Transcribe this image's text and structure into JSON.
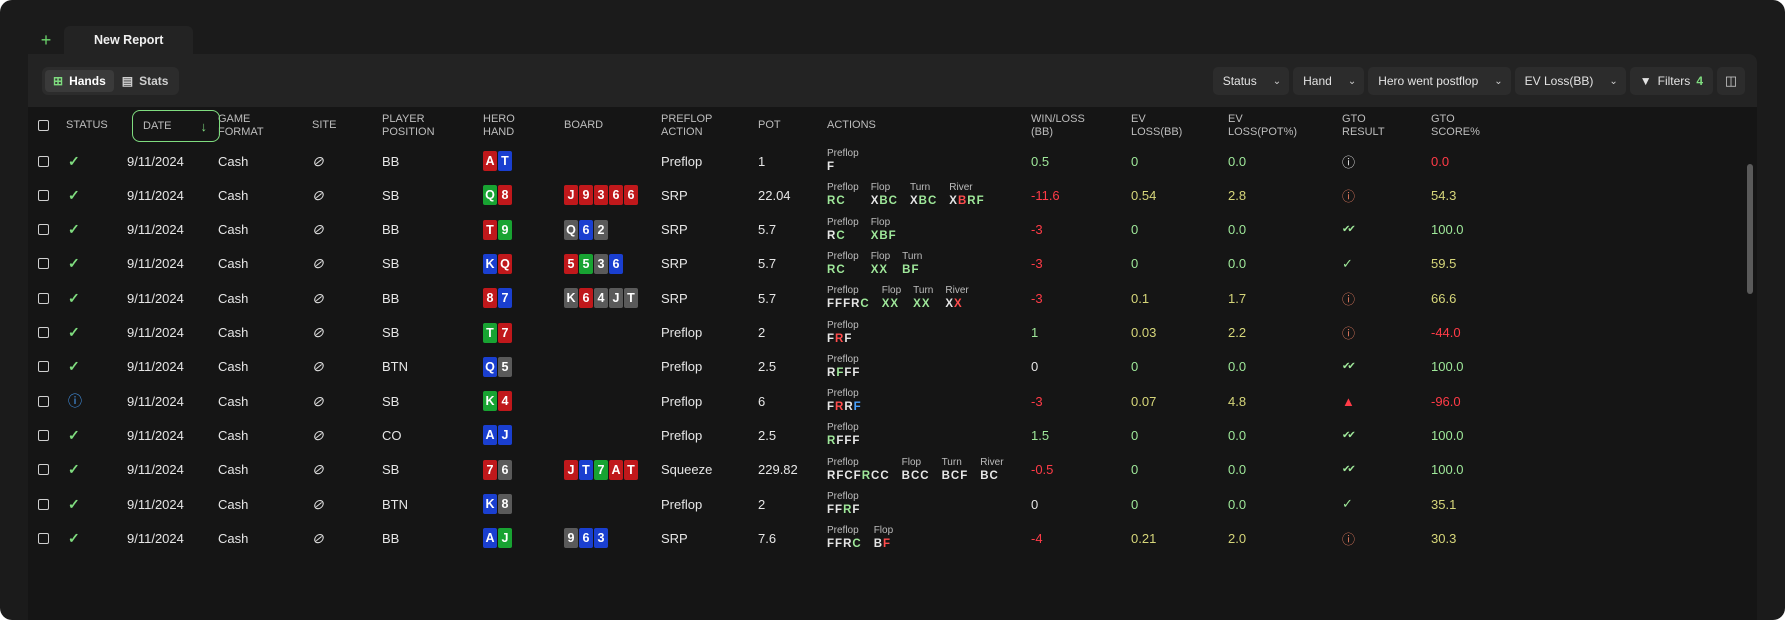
{
  "tabs": {
    "add_label": "+",
    "report_label": "New Report"
  },
  "view_toggle": {
    "hands_label": "Hands",
    "stats_label": "Stats"
  },
  "filters": {
    "status_label": "Status",
    "hand_label": "Hand",
    "postflop_label": "Hero went postflop",
    "evloss_label": "EV Loss(BB)",
    "filters_label": "Filters",
    "filters_count": "4"
  },
  "columns": {
    "status": "STATUS",
    "date": "DATE",
    "game_format": "GAME\nFORMAT",
    "site": "SITE",
    "player_position": "PLAYER\nPOSITION",
    "hero_hand": "HERO\nHAND",
    "board": "BOARD",
    "preflop_action": "PREFLOP\nACTION",
    "pot": "POT",
    "actions": "ACTIONS",
    "win_loss": "WIN/LOSS\n(BB)",
    "ev_loss_bb": "EV\nLOSS(BB)",
    "ev_loss_pot": "EV\nLOSS(POT%)",
    "gto_result": "GTO\nRESULT",
    "gto_score": "GTO\nSCORE%"
  },
  "rows": [
    {
      "status": "check",
      "date": "9/11/2024",
      "format": "Cash",
      "position": "BB",
      "hand": [
        {
          "r": "A",
          "c": "r"
        },
        {
          "r": "T",
          "c": "b"
        }
      ],
      "board": [],
      "preflop": "Preflop",
      "pot": "1",
      "actions": [
        {
          "street": "Preflop",
          "acts": [
            [
              "F",
              "w"
            ]
          ]
        }
      ],
      "winloss": "0.5",
      "wl_sign": "pos",
      "evbb": "0",
      "evbb_c": "grn",
      "evpot": "0.0",
      "evpot_c": "grn",
      "gto": "info",
      "score": "0.0",
      "score_c": "red"
    },
    {
      "status": "check",
      "date": "9/11/2024",
      "format": "Cash",
      "position": "SB",
      "hand": [
        {
          "r": "Q",
          "c": "g"
        },
        {
          "r": "8",
          "c": "r"
        }
      ],
      "board": [
        {
          "r": "J",
          "c": "r"
        },
        {
          "r": "9",
          "c": "r"
        },
        {
          "r": "3",
          "c": "r"
        },
        {
          "r": "6",
          "c": "r"
        },
        {
          "r": "6",
          "c": "r"
        }
      ],
      "preflop": "SRP",
      "pot": "22.04",
      "actions": [
        {
          "street": "Preflop",
          "acts": [
            [
              "R",
              "g"
            ],
            [
              "C",
              "g"
            ]
          ]
        },
        {
          "street": "Flop",
          "acts": [
            [
              "X",
              "w"
            ],
            [
              "B",
              "g"
            ],
            [
              "C",
              "g"
            ]
          ]
        },
        {
          "street": "Turn",
          "acts": [
            [
              "X",
              "w"
            ],
            [
              "B",
              "g"
            ],
            [
              "C",
              "g"
            ]
          ]
        },
        {
          "street": "River",
          "acts": [
            [
              "X",
              "w"
            ],
            [
              "B",
              "r"
            ],
            [
              "R",
              "g"
            ],
            [
              "F",
              "g"
            ]
          ]
        }
      ],
      "winloss": "-11.6",
      "wl_sign": "neg",
      "evbb": "0.54",
      "evbb_c": "yel",
      "evpot": "2.8",
      "evpot_c": "yel",
      "gto": "mistake",
      "score": "54.3",
      "score_c": "yel"
    },
    {
      "status": "check",
      "date": "9/11/2024",
      "format": "Cash",
      "position": "BB",
      "hand": [
        {
          "r": "T",
          "c": "r"
        },
        {
          "r": "9",
          "c": "g"
        }
      ],
      "board": [
        {
          "r": "Q",
          "c": "k"
        },
        {
          "r": "6",
          "c": "b"
        },
        {
          "r": "2",
          "c": "k"
        }
      ],
      "preflop": "SRP",
      "pot": "5.7",
      "actions": [
        {
          "street": "Preflop",
          "acts": [
            [
              "R",
              "w"
            ],
            [
              "C",
              "g"
            ]
          ]
        },
        {
          "street": "Flop",
          "acts": [
            [
              "X",
              "g"
            ],
            [
              "B",
              "g"
            ],
            [
              "F",
              "g"
            ]
          ]
        }
      ],
      "winloss": "-3",
      "wl_sign": "neg",
      "evbb": "0",
      "evbb_c": "grn",
      "evpot": "0.0",
      "evpot_c": "grn",
      "gto": "double",
      "score": "100.0",
      "score_c": "grn"
    },
    {
      "status": "check",
      "date": "9/11/2024",
      "format": "Cash",
      "position": "SB",
      "hand": [
        {
          "r": "K",
          "c": "b"
        },
        {
          "r": "Q",
          "c": "r"
        }
      ],
      "board": [
        {
          "r": "5",
          "c": "r"
        },
        {
          "r": "5",
          "c": "g"
        },
        {
          "r": "3",
          "c": "k"
        },
        {
          "r": "6",
          "c": "b"
        }
      ],
      "preflop": "SRP",
      "pot": "5.7",
      "actions": [
        {
          "street": "Preflop",
          "acts": [
            [
              "R",
              "g"
            ],
            [
              "C",
              "g"
            ]
          ]
        },
        {
          "street": "Flop",
          "acts": [
            [
              "X",
              "g"
            ],
            [
              "X",
              "g"
            ]
          ]
        },
        {
          "street": "Turn",
          "acts": [
            [
              "B",
              "g"
            ],
            [
              "F",
              "g"
            ]
          ]
        }
      ],
      "winloss": "-3",
      "wl_sign": "neg",
      "evbb": "0",
      "evbb_c": "grn",
      "evpot": "0.0",
      "evpot_c": "grn",
      "gto": "single",
      "score": "59.5",
      "score_c": "yel"
    },
    {
      "status": "check",
      "date": "9/11/2024",
      "format": "Cash",
      "position": "BB",
      "hand": [
        {
          "r": "8",
          "c": "r"
        },
        {
          "r": "7",
          "c": "b"
        }
      ],
      "board": [
        {
          "r": "K",
          "c": "k"
        },
        {
          "r": "6",
          "c": "r"
        },
        {
          "r": "4",
          "c": "k"
        },
        {
          "r": "J",
          "c": "k"
        },
        {
          "r": "T",
          "c": "k"
        }
      ],
      "preflop": "SRP",
      "pot": "5.7",
      "actions": [
        {
          "street": "Preflop",
          "acts": [
            [
              "F",
              "w"
            ],
            [
              "F",
              "w"
            ],
            [
              "F",
              "w"
            ],
            [
              "R",
              "w"
            ],
            [
              "C",
              "g"
            ]
          ]
        },
        {
          "street": "Flop",
          "acts": [
            [
              "X",
              "g"
            ],
            [
              "X",
              "g"
            ]
          ]
        },
        {
          "street": "Turn",
          "acts": [
            [
              "X",
              "g"
            ],
            [
              "X",
              "g"
            ]
          ]
        },
        {
          "street": "River",
          "acts": [
            [
              "X",
              "w"
            ],
            [
              "X",
              "r"
            ]
          ]
        }
      ],
      "winloss": "-3",
      "wl_sign": "neg",
      "evbb": "0.1",
      "evbb_c": "yel",
      "evpot": "1.7",
      "evpot_c": "yel",
      "gto": "mistake",
      "score": "66.6",
      "score_c": "yel"
    },
    {
      "status": "check",
      "date": "9/11/2024",
      "format": "Cash",
      "position": "SB",
      "hand": [
        {
          "r": "T",
          "c": "g"
        },
        {
          "r": "7",
          "c": "r"
        }
      ],
      "board": [],
      "preflop": "Preflop",
      "pot": "2",
      "actions": [
        {
          "street": "Preflop",
          "acts": [
            [
              "F",
              "w"
            ],
            [
              "R",
              "r"
            ],
            [
              "F",
              "w"
            ]
          ]
        }
      ],
      "winloss": "1",
      "wl_sign": "pos",
      "evbb": "0.03",
      "evbb_c": "yel",
      "evpot": "2.2",
      "evpot_c": "yel",
      "gto": "mistake",
      "score": "-44.0",
      "score_c": "red"
    },
    {
      "status": "check",
      "date": "9/11/2024",
      "format": "Cash",
      "position": "BTN",
      "hand": [
        {
          "r": "Q",
          "c": "b"
        },
        {
          "r": "5",
          "c": "k"
        }
      ],
      "board": [],
      "preflop": "Preflop",
      "pot": "2.5",
      "actions": [
        {
          "street": "Preflop",
          "acts": [
            [
              "R",
              "w"
            ],
            [
              "F",
              "g"
            ],
            [
              "F",
              "w"
            ],
            [
              "F",
              "w"
            ]
          ]
        }
      ],
      "winloss": "0",
      "wl_sign": "zero",
      "evbb": "0",
      "evbb_c": "grn",
      "evpot": "0.0",
      "evpot_c": "grn",
      "gto": "double",
      "score": "100.0",
      "score_c": "grn"
    },
    {
      "status": "alert",
      "date": "9/11/2024",
      "format": "Cash",
      "position": "SB",
      "hand": [
        {
          "r": "K",
          "c": "g"
        },
        {
          "r": "4",
          "c": "r"
        }
      ],
      "board": [],
      "preflop": "Preflop",
      "pot": "6",
      "actions": [
        {
          "street": "Preflop",
          "acts": [
            [
              "F",
              "w"
            ],
            [
              "R",
              "r"
            ],
            [
              "R",
              "w"
            ],
            [
              "F",
              "b"
            ]
          ]
        }
      ],
      "winloss": "-3",
      "wl_sign": "neg",
      "evbb": "0.07",
      "evbb_c": "yel",
      "evpot": "4.8",
      "evpot_c": "yel",
      "gto": "blunder",
      "score": "-96.0",
      "score_c": "red"
    },
    {
      "status": "check",
      "date": "9/11/2024",
      "format": "Cash",
      "position": "CO",
      "hand": [
        {
          "r": "A",
          "c": "b"
        },
        {
          "r": "J",
          "c": "b"
        }
      ],
      "board": [],
      "preflop": "Preflop",
      "pot": "2.5",
      "actions": [
        {
          "street": "Preflop",
          "acts": [
            [
              "R",
              "g"
            ],
            [
              "F",
              "w"
            ],
            [
              "F",
              "w"
            ],
            [
              "F",
              "w"
            ]
          ]
        }
      ],
      "winloss": "1.5",
      "wl_sign": "pos",
      "evbb": "0",
      "evbb_c": "grn",
      "evpot": "0.0",
      "evpot_c": "grn",
      "gto": "double",
      "score": "100.0",
      "score_c": "grn"
    },
    {
      "status": "check",
      "date": "9/11/2024",
      "format": "Cash",
      "position": "SB",
      "hand": [
        {
          "r": "7",
          "c": "r"
        },
        {
          "r": "6",
          "c": "k"
        }
      ],
      "board": [
        {
          "r": "J",
          "c": "r"
        },
        {
          "r": "T",
          "c": "b"
        },
        {
          "r": "7",
          "c": "g"
        },
        {
          "r": "A",
          "c": "r"
        },
        {
          "r": "T",
          "c": "r"
        }
      ],
      "preflop": "Squeeze",
      "pot": "229.82",
      "actions": [
        {
          "street": "Preflop",
          "acts": [
            [
              "R",
              "w"
            ],
            [
              "F",
              "w"
            ],
            [
              "C",
              "w"
            ],
            [
              "F",
              "w"
            ],
            [
              "R",
              "g"
            ],
            [
              "C",
              "w"
            ],
            [
              "C",
              "w"
            ]
          ]
        },
        {
          "street": "Flop",
          "acts": [
            [
              "B",
              "w"
            ],
            [
              "C",
              "w"
            ],
            [
              "C",
              "w"
            ]
          ]
        },
        {
          "street": "Turn",
          "acts": [
            [
              "B",
              "w"
            ],
            [
              "C",
              "w"
            ],
            [
              "F",
              "w"
            ]
          ]
        },
        {
          "street": "River",
          "acts": [
            [
              "B",
              "w"
            ],
            [
              "C",
              "w"
            ]
          ]
        }
      ],
      "winloss": "-0.5",
      "wl_sign": "neg",
      "evbb": "0",
      "evbb_c": "grn",
      "evpot": "0.0",
      "evpot_c": "grn",
      "gto": "double",
      "score": "100.0",
      "score_c": "grn"
    },
    {
      "status": "check",
      "date": "9/11/2024",
      "format": "Cash",
      "position": "BTN",
      "hand": [
        {
          "r": "K",
          "c": "b"
        },
        {
          "r": "8",
          "c": "k"
        }
      ],
      "board": [],
      "preflop": "Preflop",
      "pot": "2",
      "actions": [
        {
          "street": "Preflop",
          "acts": [
            [
              "F",
              "w"
            ],
            [
              "F",
              "w"
            ],
            [
              "R",
              "g"
            ],
            [
              "F",
              "w"
            ]
          ]
        }
      ],
      "winloss": "0",
      "wl_sign": "zero",
      "evbb": "0",
      "evbb_c": "grn",
      "evpot": "0.0",
      "evpot_c": "grn",
      "gto": "single",
      "score": "35.1",
      "score_c": "yel"
    },
    {
      "status": "check",
      "date": "9/11/2024",
      "format": "Cash",
      "position": "BB",
      "hand": [
        {
          "r": "A",
          "c": "b"
        },
        {
          "r": "J",
          "c": "g"
        }
      ],
      "board": [
        {
          "r": "9",
          "c": "k"
        },
        {
          "r": "6",
          "c": "b"
        },
        {
          "r": "3",
          "c": "b"
        }
      ],
      "preflop": "SRP",
      "pot": "7.6",
      "actions": [
        {
          "street": "Preflop",
          "acts": [
            [
              "F",
              "w"
            ],
            [
              "F",
              "w"
            ],
            [
              "R",
              "w"
            ],
            [
              "C",
              "g"
            ]
          ]
        },
        {
          "street": "Flop",
          "acts": [
            [
              "B",
              "w"
            ],
            [
              "F",
              "r"
            ]
          ]
        }
      ],
      "winloss": "-4",
      "wl_sign": "neg",
      "evbb": "0.21",
      "evbb_c": "yel",
      "evpot": "2.0",
      "evpot_c": "yel",
      "gto": "mistake",
      "score": "30.3",
      "score_c": "yel"
    }
  ]
}
